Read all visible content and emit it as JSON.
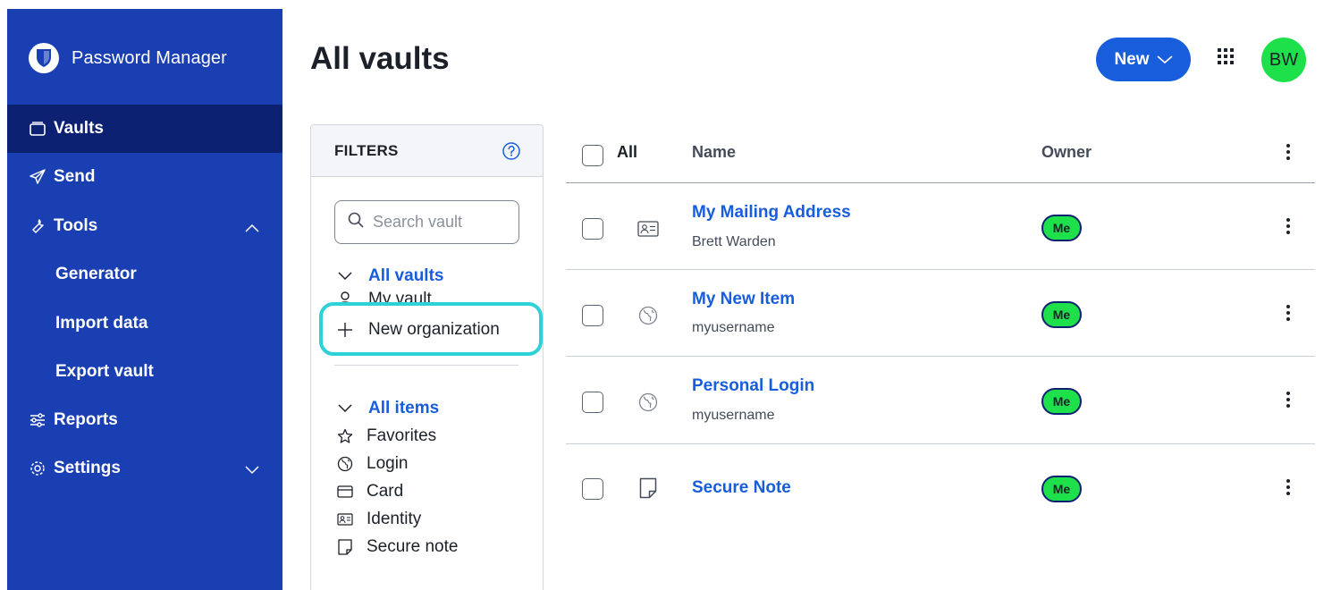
{
  "app": {
    "name": "Password Manager"
  },
  "sidebar": {
    "items": [
      {
        "label": "Vaults",
        "icon": "vault-icon",
        "active": true
      },
      {
        "label": "Send",
        "icon": "send-icon"
      },
      {
        "label": "Tools",
        "icon": "wrench-icon",
        "expanded": true
      },
      {
        "label": "Generator"
      },
      {
        "label": "Import data"
      },
      {
        "label": "Export vault"
      },
      {
        "label": "Reports",
        "icon": "sliders-icon"
      },
      {
        "label": "Settings",
        "icon": "gear-icon",
        "expanded": false
      }
    ]
  },
  "header": {
    "title": "All vaults",
    "new_label": "New",
    "avatar_initials": "BW"
  },
  "filters": {
    "title": "FILTERS",
    "search_placeholder": "Search vault",
    "vaults": {
      "heading": "All vaults",
      "items": [
        "My vault",
        "New organization"
      ]
    },
    "types": {
      "heading": "All items",
      "items": [
        "Favorites",
        "Login",
        "Card",
        "Identity",
        "Secure note"
      ]
    }
  },
  "table": {
    "columns": {
      "all": "All",
      "name": "Name",
      "owner": "Owner"
    },
    "rows": [
      {
        "name": "My Mailing Address",
        "subtitle": "Brett Warden",
        "type_icon": "identity-icon",
        "owner": "Me"
      },
      {
        "name": "My New Item",
        "subtitle": "myusername",
        "type_icon": "globe-icon",
        "owner": "Me"
      },
      {
        "name": "Personal Login",
        "subtitle": "myusername",
        "type_icon": "globe-icon",
        "owner": "Me"
      },
      {
        "name": "Secure Note",
        "subtitle": "",
        "type_icon": "note-icon",
        "owner": "Me"
      }
    ]
  },
  "colors": {
    "sidebar": "#1a3fb3",
    "sidebar_active": "#0d2172",
    "accent": "#175ddc",
    "avatar": "#1ee04a",
    "highlight": "#2ed1d8"
  }
}
